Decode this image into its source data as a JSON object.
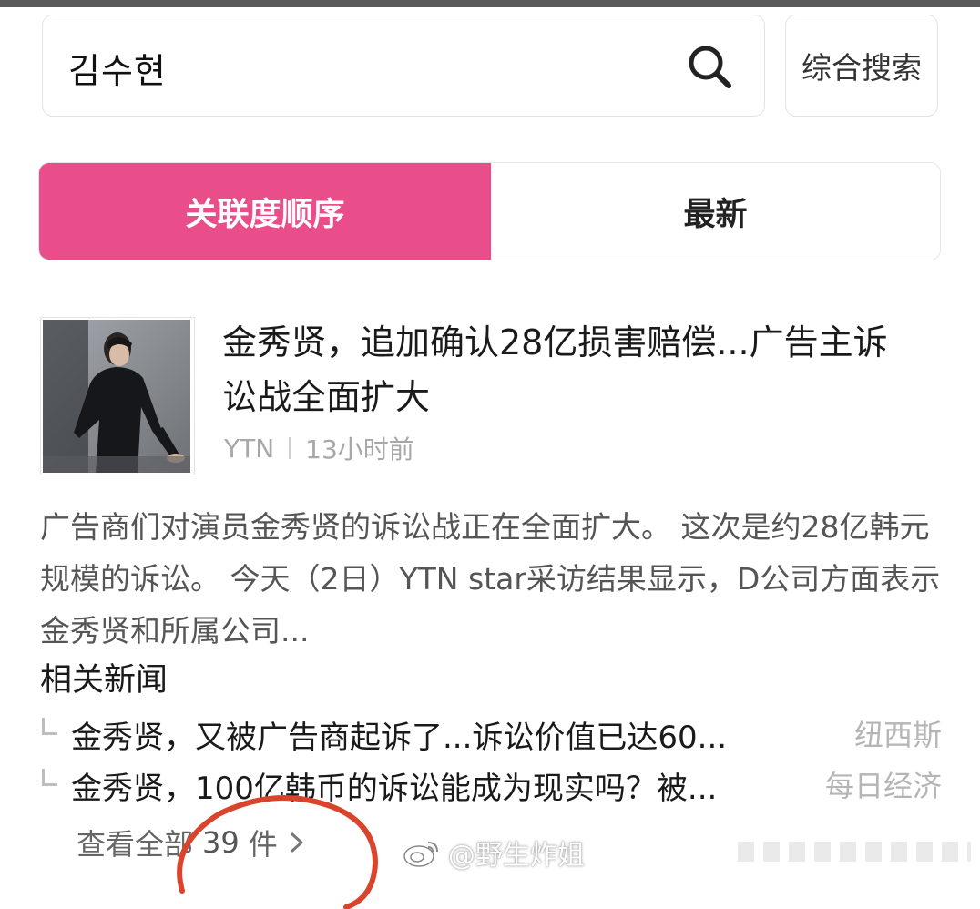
{
  "search": {
    "query": "김수현",
    "combined_search_label": "综合搜索"
  },
  "tabs": [
    {
      "label": "关联度顺序",
      "active": true
    },
    {
      "label": "最新",
      "active": false
    }
  ],
  "article": {
    "headline": "金秀贤，追加确认28亿损害赔偿...广告主诉讼战全面扩大",
    "source": "YTN",
    "time": "13小时前",
    "summary": "广告商们对演员金秀贤的诉讼战正在全面扩大。 这次是约28亿韩元规模的诉讼。 今天（2日）YTN star采访结果显示，D公司方面表示金秀贤和所属公司..."
  },
  "related": {
    "title": "相关新闻",
    "items": [
      {
        "title": "金秀贤，又被广告商起诉了...诉讼价值已达60...",
        "source": "纽西斯"
      },
      {
        "title": "金秀贤，100亿韩币的诉讼能成为现实吗？被...",
        "source": "每日经济"
      }
    ],
    "view_all_prefix": "查看全部",
    "view_all_count": "39",
    "view_all_suffix": "件"
  },
  "watermark": {
    "text": "@野生炸姐"
  },
  "colors": {
    "accent": "#e94d8a",
    "annotation_circle": "#d9452c"
  },
  "icons": [
    "search-icon",
    "chevron-right-icon",
    "weibo-logo-icon"
  ]
}
